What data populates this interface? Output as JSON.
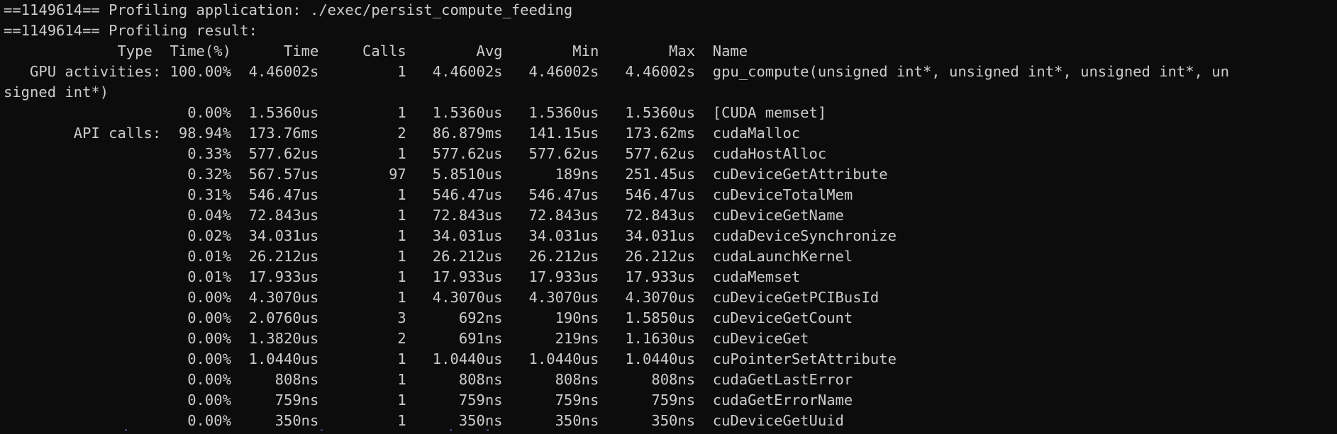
{
  "header": {
    "line1": "==1149614== Profiling application: ./exec/persist_compute_feeding",
    "line2": "==1149614== Profiling result:"
  },
  "columns": {
    "type": "Type",
    "time_pct": "Time(%)",
    "time": "Time",
    "calls": "Calls",
    "avg": "Avg",
    "min": "Min",
    "max": "Max",
    "name": "Name"
  },
  "gpu_section": {
    "label": "GPU activities:",
    "first": {
      "time_pct": "100.00%",
      "time": "4.46002s",
      "calls": "1",
      "avg": "4.46002s",
      "min": "4.46002s",
      "max": "4.46002s",
      "name": "gpu_compute(unsigned int*, unsigned int*, unsigned int*, un"
    },
    "wrap": "signed int*)",
    "second": {
      "time_pct": "0.00%",
      "time": "1.5360us",
      "calls": "1",
      "avg": "1.5360us",
      "min": "1.5360us",
      "max": "1.5360us",
      "name": "[CUDA memset]"
    }
  },
  "api_section": {
    "label": "API calls:",
    "rows": [
      {
        "time_pct": "98.94%",
        "time": "173.76ms",
        "calls": "2",
        "avg": "86.879ms",
        "min": "141.15us",
        "max": "173.62ms",
        "name": "cudaMalloc"
      },
      {
        "time_pct": "0.33%",
        "time": "577.62us",
        "calls": "1",
        "avg": "577.62us",
        "min": "577.62us",
        "max": "577.62us",
        "name": "cudaHostAlloc"
      },
      {
        "time_pct": "0.32%",
        "time": "567.57us",
        "calls": "97",
        "avg": "5.8510us",
        "min": "189ns",
        "max": "251.45us",
        "name": "cuDeviceGetAttribute"
      },
      {
        "time_pct": "0.31%",
        "time": "546.47us",
        "calls": "1",
        "avg": "546.47us",
        "min": "546.47us",
        "max": "546.47us",
        "name": "cuDeviceTotalMem"
      },
      {
        "time_pct": "0.04%",
        "time": "72.843us",
        "calls": "1",
        "avg": "72.843us",
        "min": "72.843us",
        "max": "72.843us",
        "name": "cuDeviceGetName"
      },
      {
        "time_pct": "0.02%",
        "time": "34.031us",
        "calls": "1",
        "avg": "34.031us",
        "min": "34.031us",
        "max": "34.031us",
        "name": "cudaDeviceSynchronize"
      },
      {
        "time_pct": "0.01%",
        "time": "26.212us",
        "calls": "1",
        "avg": "26.212us",
        "min": "26.212us",
        "max": "26.212us",
        "name": "cudaLaunchKernel"
      },
      {
        "time_pct": "0.01%",
        "time": "17.933us",
        "calls": "1",
        "avg": "17.933us",
        "min": "17.933us",
        "max": "17.933us",
        "name": "cudaMemset"
      },
      {
        "time_pct": "0.00%",
        "time": "4.3070us",
        "calls": "1",
        "avg": "4.3070us",
        "min": "4.3070us",
        "max": "4.3070us",
        "name": "cuDeviceGetPCIBusId"
      },
      {
        "time_pct": "0.00%",
        "time": "2.0760us",
        "calls": "3",
        "avg": "692ns",
        "min": "190ns",
        "max": "1.5850us",
        "name": "cuDeviceGetCount"
      },
      {
        "time_pct": "0.00%",
        "time": "1.3820us",
        "calls": "2",
        "avg": "691ns",
        "min": "219ns",
        "max": "1.1630us",
        "name": "cuDeviceGet"
      },
      {
        "time_pct": "0.00%",
        "time": "1.0440us",
        "calls": "1",
        "avg": "1.0440us",
        "min": "1.0440us",
        "max": "1.0440us",
        "name": "cuPointerSetAttribute"
      },
      {
        "time_pct": "0.00%",
        "time": "808ns",
        "calls": "1",
        "avg": "808ns",
        "min": "808ns",
        "max": "808ns",
        "name": "cudaGetLastError"
      },
      {
        "time_pct": "0.00%",
        "time": "759ns",
        "calls": "1",
        "avg": "759ns",
        "min": "759ns",
        "max": "759ns",
        "name": "cudaGetErrorName"
      },
      {
        "time_pct": "0.00%",
        "time": "350ns",
        "calls": "1",
        "avg": "350ns",
        "min": "350ns",
        "max": "350ns",
        "name": "cuDeviceGetUuid"
      }
    ]
  },
  "theme": {
    "background": "#0c0c0c",
    "foreground": "#cccccc"
  }
}
